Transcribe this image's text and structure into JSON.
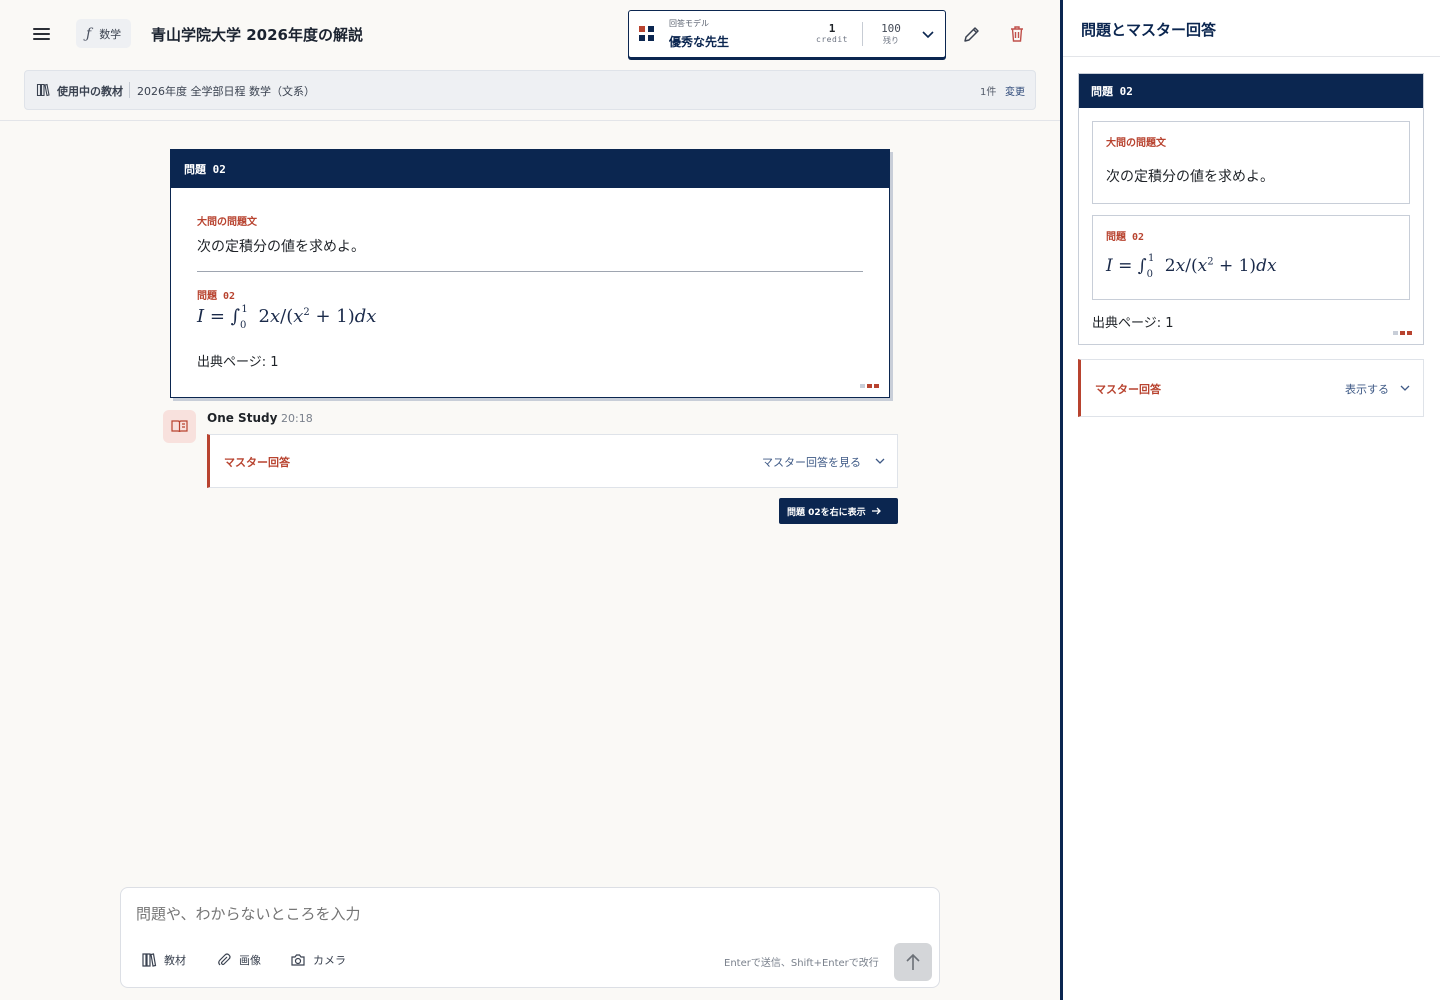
{
  "header": {
    "subject_icon": "function-icon",
    "subject": "数学",
    "title": "青山学院大学 2026年度の解説",
    "model": {
      "label_small": "回答モデル",
      "name": "優秀な先生",
      "credit_value": "1",
      "credit_unit": "credit",
      "remaining_value": "100",
      "remaining_unit": "残り"
    }
  },
  "material_bar": {
    "label": "使用中の教材",
    "name": "2026年度 全学部日程 数学（文系）",
    "count": "1件",
    "change": "変更"
  },
  "problem_card": {
    "header": "問題 02",
    "big_label": "大問の問題文",
    "big_text": "次の定積分の値を求めよ。",
    "q_label": "問題 02",
    "source": "出典ページ: 1"
  },
  "message": {
    "sender": "One Study",
    "time": "20:18",
    "master_title": "マスター回答",
    "master_toggle": "マスター回答を見る",
    "show_right": "問題 02を右に表示"
  },
  "composer": {
    "placeholder": "問題や、わからないところを入力",
    "tools": [
      "教材",
      "画像",
      "カメラ"
    ],
    "hint": "Enterで送信、Shift+Enterで改行"
  },
  "right_panel": {
    "title": "問題とマスター回答",
    "card_header": "問題 02",
    "big_label": "大問の問題文",
    "big_text": "次の定積分の値を求めよ。",
    "q_label": "問題 02",
    "source": "出典ページ: 1",
    "master_title": "マスター回答",
    "master_toggle": "表示する"
  },
  "colors": {
    "navy": "#0b2650",
    "accent_red": "#b8432f",
    "background": "#faf9f6"
  }
}
